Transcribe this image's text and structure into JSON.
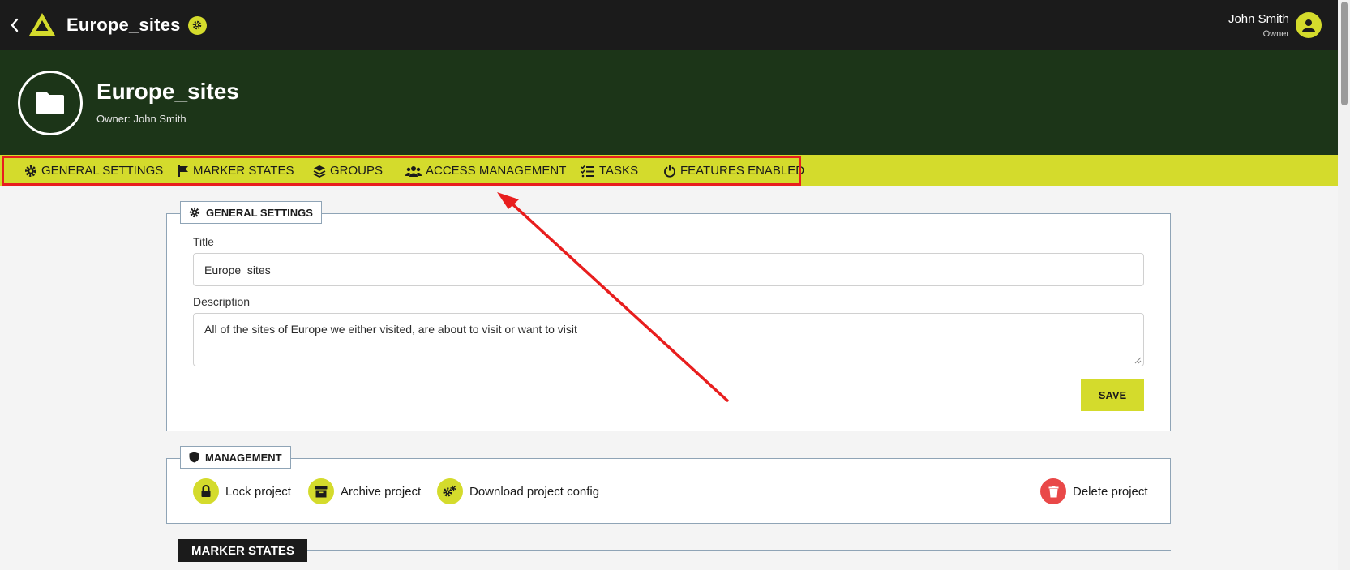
{
  "topbar": {
    "app_title": "Europe_sites",
    "user_name": "John Smith",
    "user_role": "Owner"
  },
  "header": {
    "project_title": "Europe_sites",
    "owner_line": "Owner: John Smith"
  },
  "tabs": [
    {
      "label": "GENERAL SETTINGS",
      "icon": "gear-icon"
    },
    {
      "label": "MARKER STATES",
      "icon": "flag-icon"
    },
    {
      "label": "GROUPS",
      "icon": "layers-icon"
    },
    {
      "label": "ACCESS MANAGEMENT",
      "icon": "users-icon"
    },
    {
      "label": "TASKS",
      "icon": "tasks-icon"
    },
    {
      "label": "FEATURES ENABLED",
      "icon": "power-icon"
    }
  ],
  "general_settings": {
    "legend": "GENERAL SETTINGS",
    "title_label": "Title",
    "title_value": "Europe_sites",
    "description_label": "Description",
    "description_value": "All of the sites of Europe we either visited, are about to visit or want to visit",
    "save_label": "SAVE"
  },
  "management": {
    "legend": "MANAGEMENT",
    "lock_label": "Lock project",
    "archive_label": "Archive project",
    "download_label": "Download project config",
    "delete_label": "Delete project"
  },
  "marker_states": {
    "title": "MARKER STATES"
  },
  "colors": {
    "accent": "#d4db2c",
    "topbar": "#1b1b1b",
    "header": "#1c3518",
    "annotation": "#e81e1e",
    "danger": "#e94848"
  }
}
